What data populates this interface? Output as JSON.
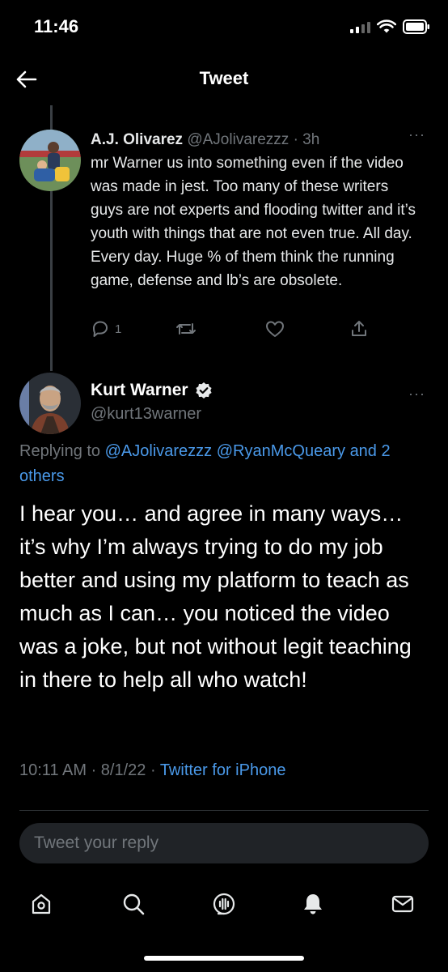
{
  "status": {
    "time": "11:46"
  },
  "header": {
    "title": "Tweet"
  },
  "parent_tweet": {
    "name": "A.J. Olivarez",
    "handle": "@AJolivarezzz",
    "time": "· 3h",
    "text": "mr Warner us into something even if the video was made in jest. Too many of these writers guys are not experts and flooding twitter and it’s youth with things that are not even true. All day. Every day. Huge % of them think the running game, defense and lb’s are obsolete.",
    "reply_count": "1"
  },
  "main_tweet": {
    "name": "Kurt Warner",
    "handle": "@kurt13warner",
    "replying_prefix": "Replying to ",
    "mention_1": "@AJolivarezzz",
    "mention_2": "@RyanMcQueary",
    "mention_others": "and 2 others",
    "text": "I hear you… and agree in many ways… it’s why I’m always trying to do my job better and using my platform to teach as much as I can… you noticed the video was a joke, but not without legit teaching in there to help all who watch!",
    "timestamp": "10:11 AM · 8/1/22 · ",
    "source": "Twitter for iPhone"
  },
  "reply": {
    "placeholder": "Tweet your reply"
  },
  "colors": {
    "accent": "#4a99e9",
    "muted": "#71767b",
    "background": "#000000"
  },
  "tabs": [
    {
      "name": "home",
      "icon": "home-icon"
    },
    {
      "name": "search",
      "icon": "search-icon"
    },
    {
      "name": "spaces",
      "icon": "spaces-icon"
    },
    {
      "name": "notifications",
      "icon": "bell-icon"
    },
    {
      "name": "messages",
      "icon": "mail-icon"
    }
  ]
}
